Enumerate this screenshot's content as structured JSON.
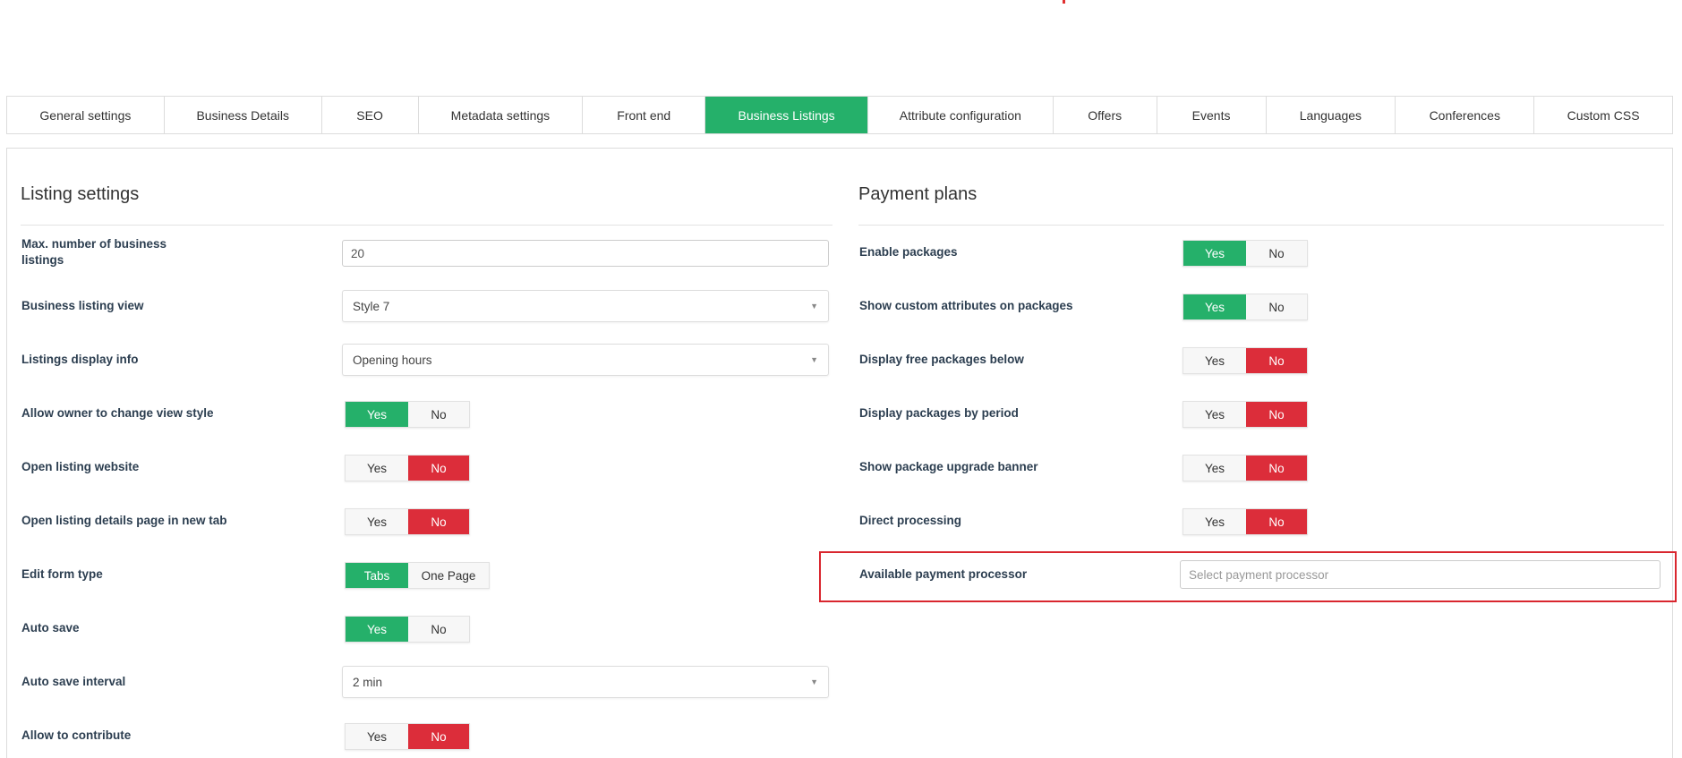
{
  "tabs": [
    {
      "label": "General settings",
      "active": false
    },
    {
      "label": "Business Details",
      "active": false
    },
    {
      "label": "SEO",
      "active": false
    },
    {
      "label": "Metadata settings",
      "active": false
    },
    {
      "label": "Front end",
      "active": false
    },
    {
      "label": "Business Listings",
      "active": true
    },
    {
      "label": "Attribute configuration",
      "active": false
    },
    {
      "label": "Offers",
      "active": false
    },
    {
      "label": "Events",
      "active": false
    },
    {
      "label": "Languages",
      "active": false
    },
    {
      "label": "Conferences",
      "active": false
    },
    {
      "label": "Custom CSS",
      "active": false
    }
  ],
  "listing": {
    "title": "Listing settings",
    "max_listings": {
      "label": "Max. number of business listings",
      "value": "20"
    },
    "listing_view": {
      "label": "Business listing view",
      "value": "Style 7"
    },
    "display_info": {
      "label": "Listings display info",
      "value": "Opening hours"
    },
    "allow_owner_change": {
      "label": "Allow owner to change view style",
      "yes": "Yes",
      "no": "No",
      "selected": "yes"
    },
    "open_website": {
      "label": "Open listing website",
      "yes": "Yes",
      "no": "No",
      "selected": "no"
    },
    "open_details_new_tab": {
      "label": "Open listing details page in new tab",
      "yes": "Yes",
      "no": "No",
      "selected": "no"
    },
    "edit_form_type": {
      "label": "Edit form type",
      "opt1": "Tabs",
      "opt2": "One Page",
      "selected": "tabs"
    },
    "auto_save": {
      "label": "Auto save",
      "yes": "Yes",
      "no": "No",
      "selected": "yes"
    },
    "auto_save_interval": {
      "label": "Auto save interval",
      "value": "2 min"
    },
    "allow_contribute": {
      "label": "Allow to contribute",
      "yes": "Yes",
      "no": "No",
      "selected": "no"
    }
  },
  "payment": {
    "title": "Payment plans",
    "enable_packages": {
      "label": "Enable packages",
      "yes": "Yes",
      "no": "No",
      "selected": "yes"
    },
    "custom_attributes": {
      "label": "Show custom attributes on packages",
      "yes": "Yes",
      "no": "No",
      "selected": "yes"
    },
    "free_below": {
      "label": "Display free packages below",
      "yes": "Yes",
      "no": "No",
      "selected": "no"
    },
    "by_period": {
      "label": "Display packages by period",
      "yes": "Yes",
      "no": "No",
      "selected": "no"
    },
    "upgrade_banner": {
      "label": "Show package upgrade banner",
      "yes": "Yes",
      "no": "No",
      "selected": "no"
    },
    "direct_processing": {
      "label": "Direct processing",
      "yes": "Yes",
      "no": "No",
      "selected": "no"
    },
    "processor": {
      "label": "Available payment processor",
      "placeholder": "Select payment processor"
    }
  },
  "colors": {
    "yes_active": "#25b06a",
    "no_active": "#dc2d3a",
    "highlight": "#d9262e",
    "label": "#2c3e50"
  }
}
